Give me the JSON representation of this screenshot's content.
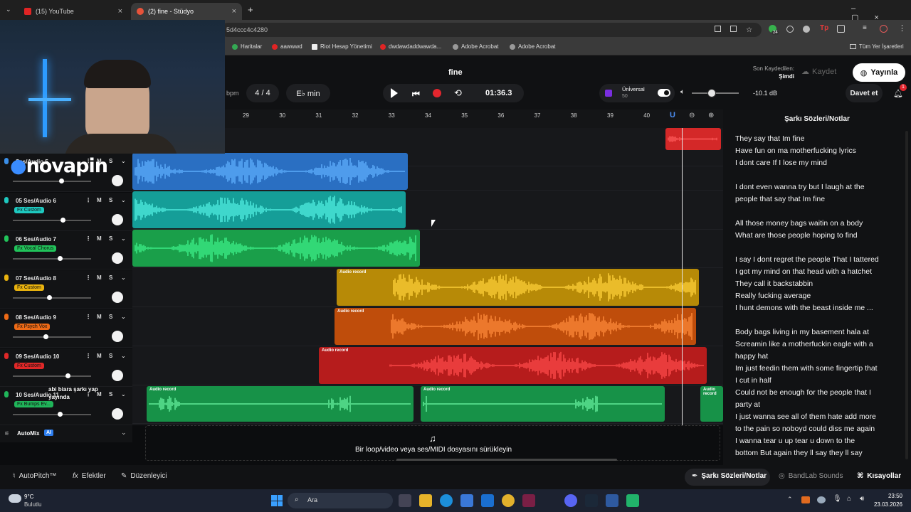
{
  "browser": {
    "tabs": [
      {
        "label": "(15) YouTube",
        "active": false
      },
      {
        "label": "(2) fine - Stüdyo",
        "active": true
      }
    ],
    "url": "5d4ccc4c4280",
    "bookmarks": [
      "Haritalar",
      "aawwwd",
      "Riot Hesap Yönetimi",
      "dwdawdaddwawda...",
      "Adobe Acrobat",
      "Adobe Acrobat"
    ],
    "bookmarks_right": "Tüm Yer İşaretleri",
    "new_tab": "+",
    "ext_badge": "24"
  },
  "header": {
    "song_title": "fine",
    "bpm_label": "bpm",
    "time_signature": "4 / 4",
    "key": "E♭ min",
    "timecode": "01:36.3",
    "last_saved_label": "Son Kaydedilen:",
    "last_saved_value": "Şimdi",
    "save_label": "Kaydet",
    "publish_label": "Yayınla",
    "invite_label": "Davet et",
    "notification_count": "1",
    "instrument_name": "Ünİversal",
    "instrument_value": "50",
    "volume_db": "-10.1 dB"
  },
  "ruler": [
    "29",
    "30",
    "31",
    "32",
    "33",
    "34",
    "35",
    "36",
    "37",
    "38",
    "39",
    "40"
  ],
  "tracks": [
    {
      "num": "",
      "name": "Ses/Audio 5",
      "fx": "",
      "color": "#3b8fe8",
      "volume": 0.62
    },
    {
      "num": "05",
      "name": "Ses/Audio 6",
      "fx": "Fx Custom",
      "color": "#1ec9c0",
      "volume": 0.64
    },
    {
      "num": "06",
      "name": "Ses/Audio 7",
      "fx": "Fx Vocal Chorus",
      "color": "#21c35a",
      "volume": 0.6
    },
    {
      "num": "07",
      "name": "Ses/Audio 8",
      "fx": "Fx Custom",
      "color": "#e9b20e",
      "volume": 0.46
    },
    {
      "num": "08",
      "name": "Ses/Audio 9",
      "fx": "Fx Psych Vox",
      "color": "#ee6a16",
      "volume": 0.42
    },
    {
      "num": "09",
      "name": "Ses/Audio 10",
      "fx": "Fx Custom",
      "color": "#e02828",
      "volume": 0.7
    },
    {
      "num": "10",
      "name": "Ses/Audio 11",
      "fx": "Fx Bumps Ev...",
      "color": "#20b55a",
      "volume": 0.6
    }
  ],
  "clip_label": "Audio record",
  "overlay_text": "abi biara şarkı yap yayında",
  "logo_text": "novapin",
  "automix_label": "AutoMix",
  "automix_badge": "AI",
  "drop_hint": "Bir loop/video veya ses/MIDI dosyasını sürükleyin",
  "lyrics": {
    "title": "Şarkı Sözleri/Notlar",
    "stanzas": [
      [
        "They say that Im fine",
        "Have fun on ma motherfucking lyrics",
        "I dont care If I lose my mind"
      ],
      [
        "I dont even wanna try but I laugh at the",
        "people that say that Im fine"
      ],
      [
        "All those money bags waitin on a body",
        "What are those people hoping to find"
      ],
      [
        "I say I dont regret the people That I tattered",
        "I got my mind on that head with a hatchet",
        "They call it backstabbin",
        "Really fucking average",
        "I hunt demons with the beast inside me ..."
      ],
      [
        "Body bags living in my basement hala at",
        "Screamin like a motherfuckin eagle with a",
        "happy hat",
        "Im just feedin them with some fingertip that",
        "I cut in half",
        "Could not be enough for the people that I",
        "party at",
        "I just wanna see all of them hate add more",
        "to the pain so noboyd could diss me again",
        "I wanna tear u up tear u down to the",
        "bottom But again they ll say they ll say"
      ]
    ]
  },
  "bottom_bar": {
    "autopitch": "AutoPitch™",
    "effects": "Efektler",
    "editor": "Düzenleyici",
    "lyrics": "Şarkı Sözleri/Notlar",
    "sounds": "BandLab Sounds",
    "shortcuts": "Kısayollar"
  },
  "taskbar": {
    "weather_temp": "9°C",
    "weather_desc": "Bulutlu",
    "search_label": "Ara",
    "time": "23:50",
    "date": "23.03.2026"
  }
}
